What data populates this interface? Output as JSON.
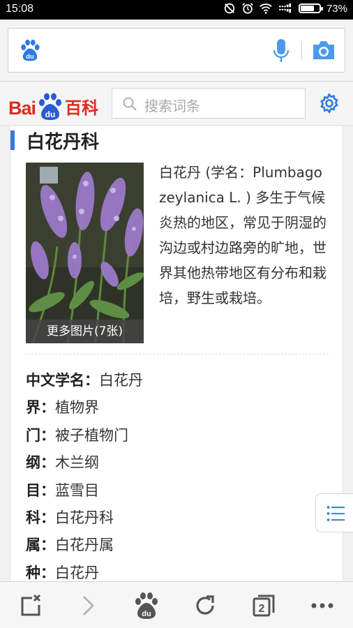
{
  "status_bar": {
    "time": "15:08",
    "battery_percent": "73%",
    "battery_level": 0.73,
    "icons": [
      "dnd-icon",
      "alarm-icon",
      "wifi-icon",
      "network-speed-icon"
    ]
  },
  "browser": {
    "address_icon": "baidu-paw-icon",
    "voice_icon": "microphone-icon",
    "camera_icon": "camera-icon",
    "accent_color": "#4d9be8"
  },
  "baike": {
    "logo_bai": "Bai",
    "logo_du": "du",
    "logo_baike": "百科",
    "search_placeholder": "搜索词条",
    "brand_red": "#de2b1f",
    "brand_blue": "#2a5bd7"
  },
  "article": {
    "title": "白花丹科",
    "image_caption": "更多图片(7张)",
    "summary": "白花丹 (学名：Plumbago zeylanica L. ) 多生于气候炎热的地区，常见于阴湿的沟边或村边路旁的旷地，世界其他热带地区有分布和栽培，野生或栽培。",
    "info": [
      {
        "key": "中文学名：",
        "value": "白花丹"
      },
      {
        "key": "界：",
        "value": "植物界"
      },
      {
        "key": "门：",
        "value": "被子植物门"
      },
      {
        "key": "纲：",
        "value": "木兰纲"
      },
      {
        "key": "目：",
        "value": "蓝雪目"
      },
      {
        "key": "科：",
        "value": "白花丹科"
      },
      {
        "key": "属：",
        "value": "白花丹属"
      },
      {
        "key": "种：",
        "value": "白花丹"
      }
    ]
  },
  "toolbar": {
    "items": [
      "close-tab-icon",
      "forward-icon",
      "baidu-home-icon",
      "refresh-icon",
      "tabs-icon",
      "more-icon"
    ],
    "tab_count": "2"
  }
}
